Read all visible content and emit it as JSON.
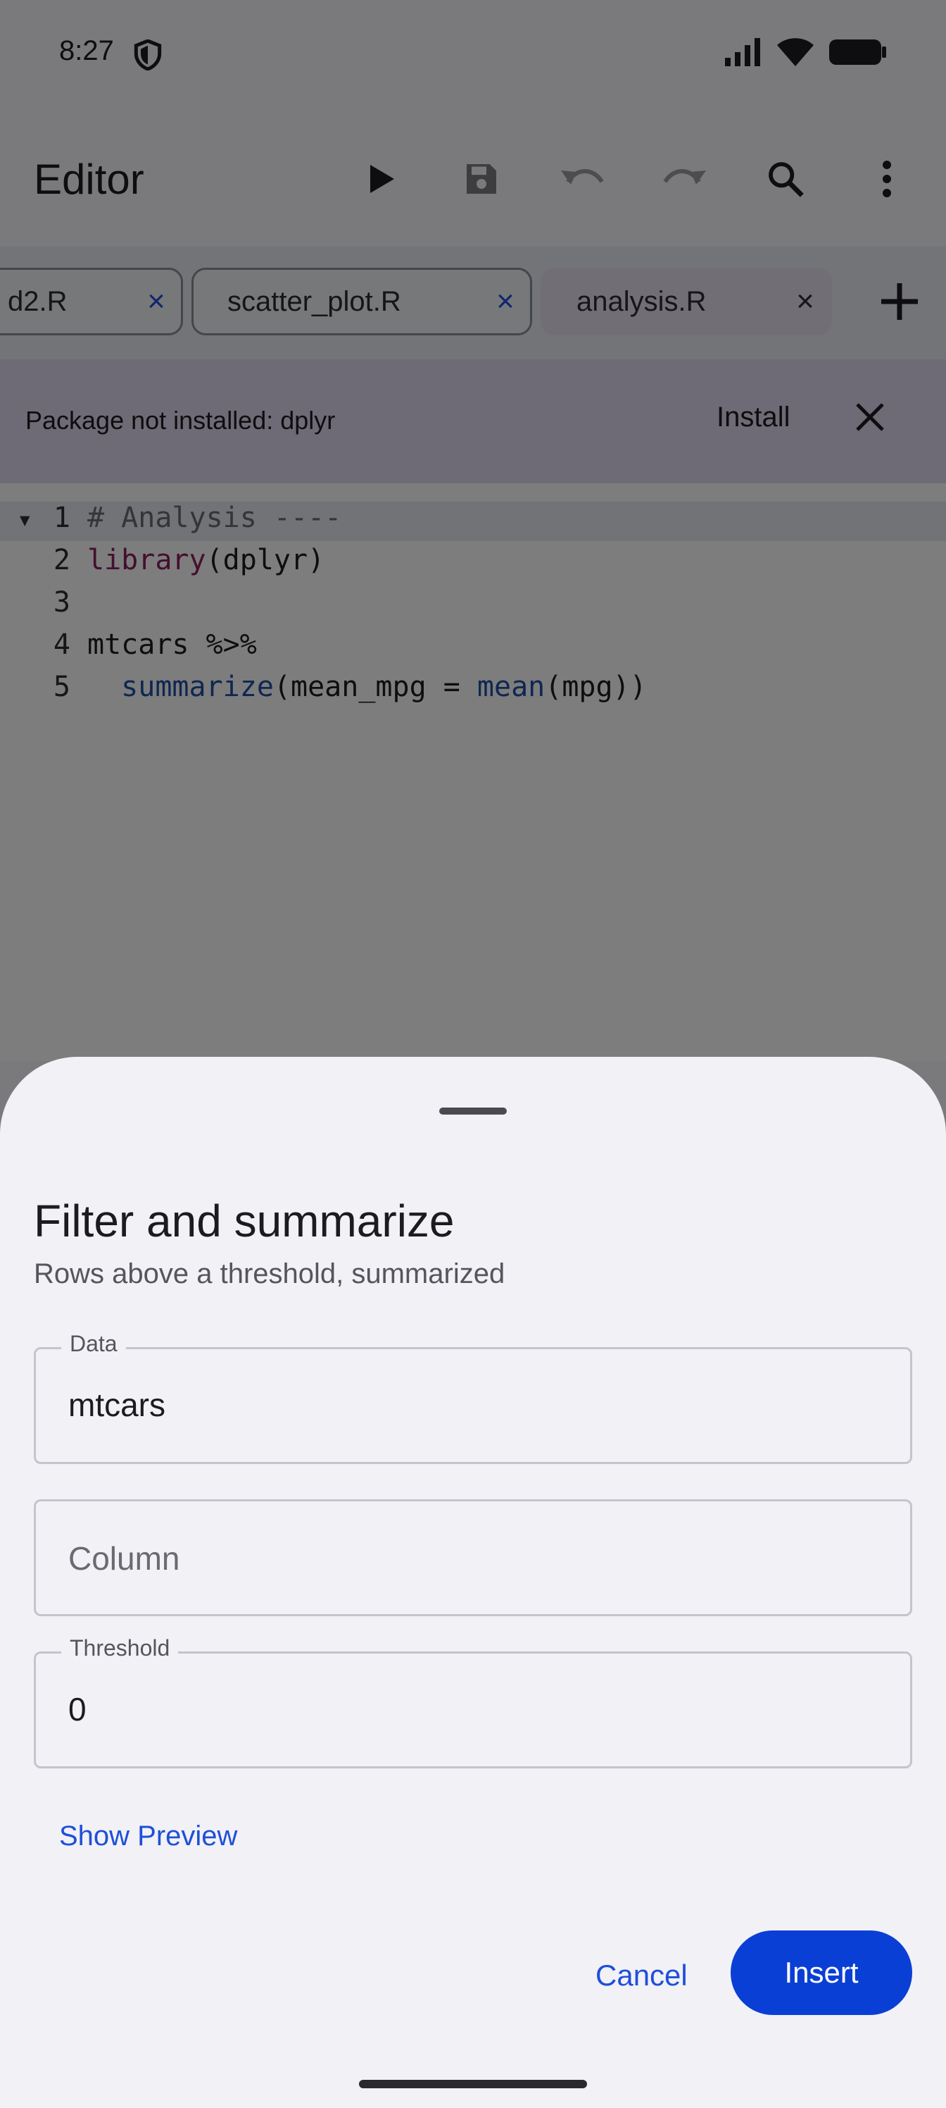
{
  "status_bar": {
    "time": "8:27"
  },
  "app_bar": {
    "title": "Editor",
    "icons": [
      "play-icon",
      "save-icon",
      "undo-icon",
      "redo-icon",
      "search-icon",
      "more-vert-icon"
    ]
  },
  "tabs": [
    {
      "label": "d2.R",
      "active": false
    },
    {
      "label": "scatter_plot.R",
      "active": false
    },
    {
      "label": "analysis.R",
      "active": true
    }
  ],
  "tab_close_glyph": "×",
  "banner": {
    "text": "Package not installed: dplyr",
    "action": "Install"
  },
  "editor": {
    "lines": [
      {
        "number": "1",
        "text": "# Analysis ----"
      },
      {
        "number": "2",
        "fn": "library",
        "rest": "(dplyr)"
      },
      {
        "number": "3",
        "text": ""
      },
      {
        "number": "4",
        "text": "mtcars %>%"
      },
      {
        "number": "5",
        "indent": "  ",
        "fn": "summarize",
        "mid": "(mean_mpg = ",
        "fn2": "mean",
        "rest": "(mpg))"
      }
    ]
  },
  "sheet": {
    "title": "Filter and summarize",
    "subtitle": "Rows above a threshold, summarized",
    "fields": {
      "data": {
        "label": "Data",
        "value": "mtcars"
      },
      "column": {
        "placeholder": "Column",
        "value": ""
      },
      "threshold": {
        "label": "Threshold",
        "value": "0"
      }
    },
    "preview_label": "Show Preview",
    "cancel_label": "Cancel",
    "insert_label": "Insert"
  },
  "colors": {
    "accent": "#0a3fd6",
    "banner_bg": "#ddd4ec",
    "active_tab_bg": "#e2dced"
  }
}
